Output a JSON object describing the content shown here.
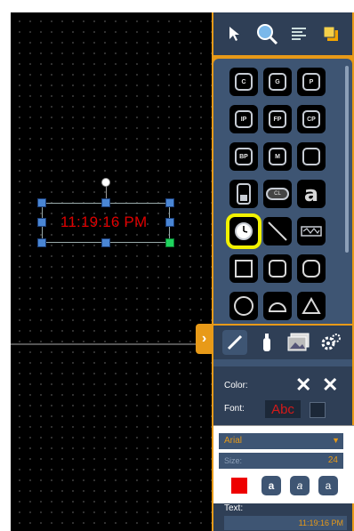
{
  "canvas": {
    "clock_text": "11:19:16 PM",
    "clock_color": "#e00000"
  },
  "toolbar": {
    "tools": [
      {
        "name": "pointer-icon",
        "glyph": "➤"
      },
      {
        "name": "zoom-icon",
        "glyph": "🔍"
      },
      {
        "name": "align-icon",
        "glyph": "☰"
      },
      {
        "name": "layers-icon",
        "glyph": "▮"
      }
    ]
  },
  "shapes": {
    "rows": [
      [
        "C",
        "G",
        "P"
      ],
      [
        "IP",
        "FP",
        "CP"
      ],
      [
        "BP",
        "M",
        ""
      ],
      [
        "",
        "CL",
        "a"
      ],
      [
        "clock",
        "line",
        "wave"
      ],
      [
        "",
        "",
        ""
      ],
      [
        "",
        "",
        ""
      ]
    ]
  },
  "tabs": [
    "pencil-icon",
    "bottle-icon",
    "image-icon",
    "gears-icon"
  ],
  "props": {
    "color_label": "Color:",
    "font_label": "Font:",
    "font_preview": "Abc",
    "font_name": "Arial",
    "size_label": "Size:",
    "size_value": "24",
    "text_label": "Text:",
    "text_value": "11:19:16 PM",
    "color_swatch": "#ee0000"
  },
  "collapse_glyph": "›",
  "accent_color": "#e89a18"
}
